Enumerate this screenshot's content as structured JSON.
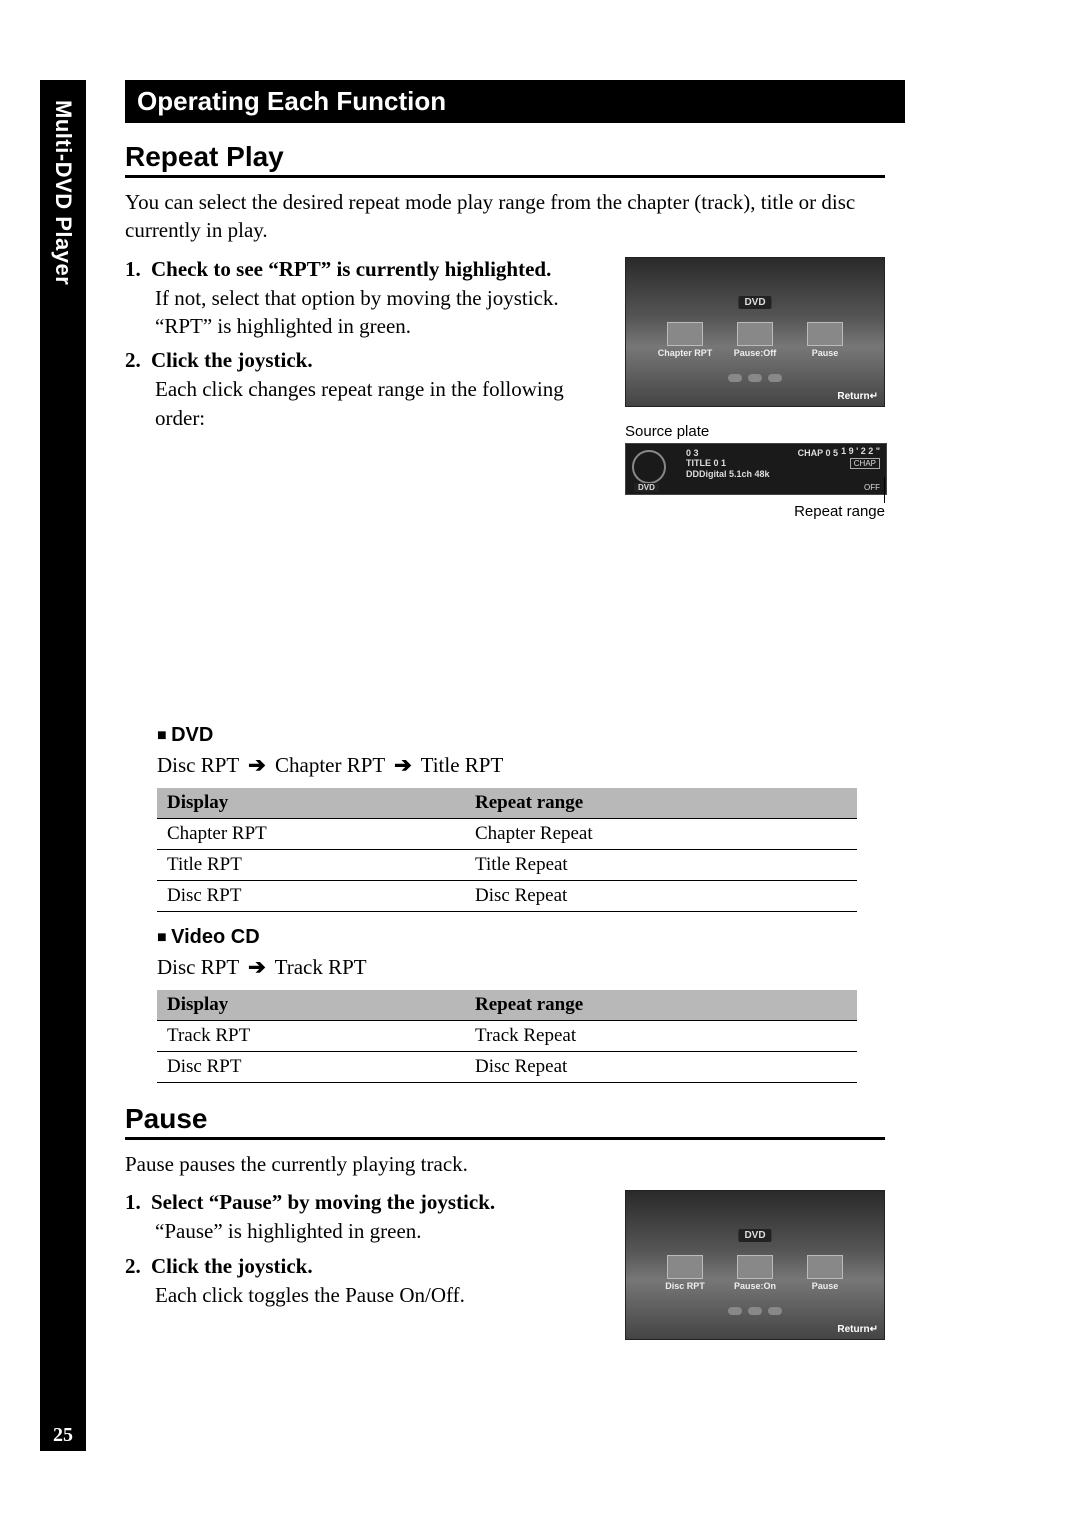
{
  "sidebar_label": "Multi-DVD Player",
  "title_bar": "Operating Each Function",
  "repeat": {
    "heading": "Repeat Play",
    "intro": "You can select the desired repeat mode play range from the chapter (track), title or disc currently in play.",
    "steps": [
      {
        "num": "1.",
        "head": "Check to see “RPT” is currently highlighted.",
        "body": "If not, select that option by moving the joystick. “RPT” is highlighted in green."
      },
      {
        "num": "2.",
        "head": "Click the joystick.",
        "body": "Each click changes repeat range in the following order:"
      }
    ],
    "screenshot": {
      "dvd_tag": "DVD",
      "items": [
        "Chapter RPT",
        "Pause:Off",
        "Pause"
      ],
      "return": "Return↵"
    },
    "source_plate": {
      "caption": "Source plate",
      "line1": "0 3",
      "line2": "TITLE 0 1",
      "line3": "DDDigital 5.1ch 48k",
      "chap": "CHAP 0 5",
      "time": "1 9 ' 2 2 \"",
      "chap_box": "CHAP",
      "off": "OFF",
      "dvd": "DVD"
    },
    "repeat_range_caption": "Repeat range",
    "dvd": {
      "sub_head": "DVD",
      "sequence": [
        "Disc RPT",
        "Chapter RPT",
        "Title RPT"
      ],
      "table": {
        "headers": [
          "Display",
          "Repeat range"
        ],
        "rows": [
          [
            "Chapter RPT",
            "Chapter Repeat"
          ],
          [
            "Title RPT",
            "Title Repeat"
          ],
          [
            "Disc RPT",
            "Disc Repeat"
          ]
        ]
      }
    },
    "vcd": {
      "sub_head": "Video CD",
      "sequence": [
        "Disc RPT",
        "Track RPT"
      ],
      "table": {
        "headers": [
          "Display",
          "Repeat range"
        ],
        "rows": [
          [
            "Track RPT",
            "Track Repeat"
          ],
          [
            "Disc RPT",
            "Disc Repeat"
          ]
        ]
      }
    }
  },
  "pause": {
    "heading": "Pause",
    "intro": "Pause pauses the currently playing track.",
    "steps": [
      {
        "num": "1.",
        "head": "Select “Pause” by moving the joystick.",
        "body": "“Pause” is highlighted in green."
      },
      {
        "num": "2.",
        "head": "Click the joystick.",
        "body": "Each click toggles the Pause On/Off."
      }
    ],
    "screenshot": {
      "dvd_tag": "DVD",
      "items": [
        "Disc RPT",
        "Pause:On",
        "Pause"
      ],
      "return": "Return↵"
    }
  },
  "page_number": "25",
  "arrow_glyph": "➔"
}
